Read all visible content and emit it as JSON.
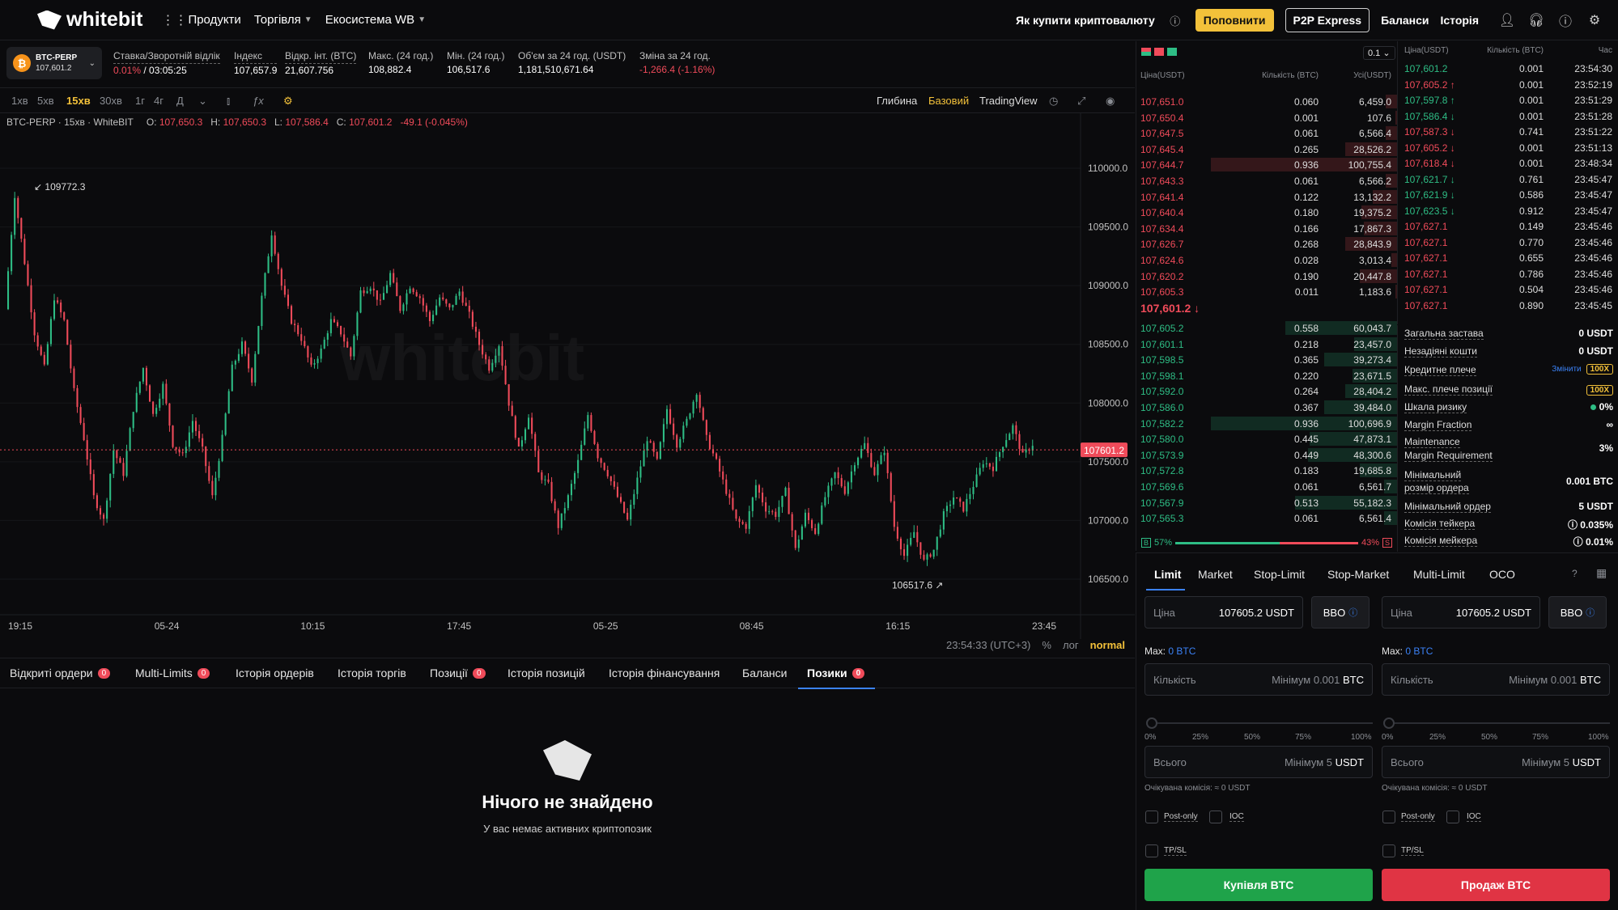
{
  "header": {
    "brand": "whitebit",
    "nav": [
      {
        "label": "Продукти"
      },
      {
        "label": "Торгівля"
      },
      {
        "label": "Екосистема WB"
      }
    ],
    "how_to_buy": "Як купити криптовалюту",
    "deposit": "Поповнити",
    "p2p": "P2P Express",
    "balances": "Баланси",
    "history": "Історія"
  },
  "ticker": {
    "pair": "BTC-PERP",
    "pair_price": "107,601.2",
    "rate_label": "Ставка/Зворотній відлік",
    "rate_value": "0.01%",
    "countdown": " / 03:05:25",
    "index_label": "Індекс",
    "index_value": "107,657.9",
    "oi_label": "Відкр. інт. (BTC)",
    "oi_value": "21,607.756",
    "high_label": "Макс. (24 год.)",
    "high_value": "108,882.4",
    "low_label": "Мін. (24 год.)",
    "low_value": "106,517.6",
    "vol_label": "Об'єм за 24 год. (USDT)",
    "vol_value": "1,181,510,671.64",
    "change_label": "Зміна за 24 год.",
    "change_value": "-1,266.4  (-1.16%)"
  },
  "chart_toolbar": {
    "intervals": [
      "1хв",
      "5хв",
      "15хв",
      "30хв",
      "1г",
      "4г",
      "Д"
    ],
    "active_interval": "15хв",
    "views": [
      "Глибина",
      "Базовий",
      "TradingView"
    ],
    "active_view": "Базовий"
  },
  "ohlc": {
    "symbol": "BTC-PERP · 15хв · WhiteBIT",
    "o_label": "O:",
    "o": "107,650.3",
    "h_label": "H:",
    "h": "107,650.3",
    "l_label": "L:",
    "l": "107,586.4",
    "c_label": "C:",
    "c": "107,601.2",
    "change": "-49.1 (-0.045%)"
  },
  "chart_data": {
    "type": "candlestick",
    "y_ticks": [
      "110000.0",
      "109500.0",
      "109000.0",
      "108500.0",
      "108000.0",
      "107500.0",
      "107000.0",
      "106500.0"
    ],
    "ylim": [
      106300,
      110400
    ],
    "x_ticks": [
      "19:15",
      "05-24",
      "10:15",
      "17:45",
      "05-25",
      "08:45",
      "16:15",
      "23:45"
    ],
    "last_price": "107601.2",
    "last_value": 107601.2,
    "max_label": "109772.3",
    "max_value": 109772.3,
    "min_label": "106517.6",
    "min_value": 106517.6,
    "time": "23:54:33 (UTC+3)",
    "opts": [
      "%",
      "лог",
      "normal"
    ],
    "watermark": "whitebit",
    "path": [
      108800,
      109772,
      109200,
      108600,
      108300,
      108900,
      108700,
      108100,
      107700,
      107200,
      107000,
      107600,
      107400,
      107950,
      108300,
      107900,
      108150,
      107650,
      107550,
      107850,
      107600,
      107200,
      107700,
      108300,
      108500,
      108200,
      108900,
      109450,
      109000,
      108700,
      108550,
      108300,
      108450,
      108700,
      108600,
      108400,
      108950,
      109000,
      108850,
      109100,
      108800,
      109000,
      108900,
      108700,
      108900,
      108800,
      108950,
      108750,
      108500,
      108300,
      108500,
      108000,
      107600,
      107900,
      107400,
      107300,
      106950,
      107200,
      107500,
      107900,
      107550,
      107400,
      107200,
      107000,
      107350,
      107700,
      107500,
      107950,
      107650,
      107850,
      108100,
      107700,
      107500,
      107250,
      107000,
      106950,
      107300,
      107100,
      107050,
      107250,
      106750,
      107050,
      106900,
      107200,
      107400,
      107250,
      107500,
      107650,
      107400,
      107600,
      106950,
      106700,
      106900,
      106650,
      106750,
      107050,
      107200,
      107100,
      107300,
      107500,
      107450,
      107650,
      107800,
      107550,
      107650
    ]
  },
  "bottom_tabs": [
    {
      "label": "Відкриті ордери",
      "badge": "0"
    },
    {
      "label": "Multi-Limits",
      "badge": "0"
    },
    {
      "label": "Історія ордерів"
    },
    {
      "label": "Історія торгів"
    },
    {
      "label": "Позиції",
      "badge": "0"
    },
    {
      "label": "Історія позицій"
    },
    {
      "label": "Історія фінансування"
    },
    {
      "label": "Баланси"
    },
    {
      "label": "Позики",
      "badge": "0"
    }
  ],
  "active_bottom_tab": "Позики",
  "empty": {
    "title": "Нічого не знайдено",
    "subtitle": "У вас немає активних криптопозик"
  },
  "orderbook": {
    "precision": "0.1",
    "headers": [
      "Ціна(USDT)",
      "Кількість (BTC)",
      "Усі(USDT)"
    ],
    "asks": [
      {
        "p": "107,651.0",
        "q": "0.060",
        "s": "6,459.0",
        "d": 0.06
      },
      {
        "p": "107,650.4",
        "q": "0.001",
        "s": "107.6",
        "d": 0.01
      },
      {
        "p": "107,647.5",
        "q": "0.061",
        "s": "6,566.4",
        "d": 0.06
      },
      {
        "p": "107,645.4",
        "q": "0.265",
        "s": "28,526.2",
        "d": 0.28
      },
      {
        "p": "107,644.7",
        "q": "0.936",
        "s": "100,755.4",
        "d": 1.0
      },
      {
        "p": "107,643.3",
        "q": "0.061",
        "s": "6,566.2",
        "d": 0.06
      },
      {
        "p": "107,641.4",
        "q": "0.122",
        "s": "13,132.2",
        "d": 0.13
      },
      {
        "p": "107,640.4",
        "q": "0.180",
        "s": "19,375.2",
        "d": 0.19
      },
      {
        "p": "107,634.4",
        "q": "0.166",
        "s": "17,867.3",
        "d": 0.18
      },
      {
        "p": "107,626.7",
        "q": "0.268",
        "s": "28,843.9",
        "d": 0.28
      },
      {
        "p": "107,624.6",
        "q": "0.028",
        "s": "3,013.4",
        "d": 0.03
      },
      {
        "p": "107,620.2",
        "q": "0.190",
        "s": "20,447.8",
        "d": 0.2
      },
      {
        "p": "107,605.3",
        "q": "0.011",
        "s": "1,183.6",
        "d": 0.01
      }
    ],
    "mid": "107,601.2 ↓",
    "bids": [
      {
        "p": "107,605.2",
        "q": "0.558",
        "s": "60,043.7",
        "d": 0.6
      },
      {
        "p": "107,601.1",
        "q": "0.218",
        "s": "23,457.0",
        "d": 0.23
      },
      {
        "p": "107,598.5",
        "q": "0.365",
        "s": "39,273.4",
        "d": 0.39
      },
      {
        "p": "107,598.1",
        "q": "0.220",
        "s": "23,671.5",
        "d": 0.24
      },
      {
        "p": "107,592.0",
        "q": "0.264",
        "s": "28,404.2",
        "d": 0.28
      },
      {
        "p": "107,586.0",
        "q": "0.367",
        "s": "39,484.0",
        "d": 0.39
      },
      {
        "p": "107,582.2",
        "q": "0.936",
        "s": "100,696.9",
        "d": 1.0
      },
      {
        "p": "107,580.0",
        "q": "0.445",
        "s": "47,873.1",
        "d": 0.47
      },
      {
        "p": "107,573.9",
        "q": "0.449",
        "s": "48,300.6",
        "d": 0.48
      },
      {
        "p": "107,572.8",
        "q": "0.183",
        "s": "19,685.8",
        "d": 0.2
      },
      {
        "p": "107,569.6",
        "q": "0.061",
        "s": "6,561.7",
        "d": 0.07
      },
      {
        "p": "107,567.9",
        "q": "0.513",
        "s": "55,182.3",
        "d": 0.55
      },
      {
        "p": "107,565.3",
        "q": "0.061",
        "s": "6,561.4",
        "d": 0.07
      }
    ],
    "buy_pct": "57%",
    "sell_pct": "43%",
    "buy_ratio": 0.57,
    "b_label": "B",
    "s_label": "S"
  },
  "trades": {
    "headers": [
      "Ціна(USDT)",
      "Кількість (BTC)",
      "Час"
    ],
    "rows": [
      {
        "p": "107,601.2",
        "q": "0.001",
        "t": "23:54:30",
        "side": "buy"
      },
      {
        "p": "107,605.2 ↑",
        "q": "0.001",
        "t": "23:52:19",
        "side": "sell"
      },
      {
        "p": "107,597.8 ↑",
        "q": "0.001",
        "t": "23:51:29",
        "side": "buy"
      },
      {
        "p": "107,586.4 ↓",
        "q": "0.001",
        "t": "23:51:28",
        "side": "buy"
      },
      {
        "p": "107,587.3 ↓",
        "q": "0.741",
        "t": "23:51:22",
        "side": "sell"
      },
      {
        "p": "107,605.2 ↓",
        "q": "0.001",
        "t": "23:51:13",
        "side": "sell"
      },
      {
        "p": "107,618.4 ↓",
        "q": "0.001",
        "t": "23:48:34",
        "side": "sell"
      },
      {
        "p": "107,621.7 ↓",
        "q": "0.761",
        "t": "23:45:47",
        "side": "buy"
      },
      {
        "p": "107,621.9 ↓",
        "q": "0.586",
        "t": "23:45:47",
        "side": "buy"
      },
      {
        "p": "107,623.5 ↓",
        "q": "0.912",
        "t": "23:45:47",
        "side": "buy"
      },
      {
        "p": "107,627.1",
        "q": "0.149",
        "t": "23:45:46",
        "side": "sell"
      },
      {
        "p": "107,627.1",
        "q": "0.770",
        "t": "23:45:46",
        "side": "sell"
      },
      {
        "p": "107,627.1",
        "q": "0.655",
        "t": "23:45:46",
        "side": "sell"
      },
      {
        "p": "107,627.1",
        "q": "0.786",
        "t": "23:45:46",
        "side": "sell"
      },
      {
        "p": "107,627.1",
        "q": "0.504",
        "t": "23:45:46",
        "side": "sell"
      },
      {
        "p": "107,627.1",
        "q": "0.890",
        "t": "23:45:45",
        "side": "sell"
      }
    ]
  },
  "account": {
    "total_margin_label": "Загальна застава",
    "total_margin": "0 USDT",
    "free_label": "Незадіяні кошти",
    "free": "0 USDT",
    "leverage_label": "Кредитне плече",
    "leverage_change": "Змінити",
    "leverage": "100X",
    "max_lev_label": "Макс. плече позиції",
    "max_lev": "100X",
    "risk_label": "Шкала ризику",
    "risk": "0%",
    "mf_label": "Margin Fraction",
    "mf": "∞",
    "mmr_label1": "Maintenance",
    "mmr_label2": "Margin Requirement",
    "mmr": "3%",
    "min_size_label1": "Мінімальний",
    "min_size_label2": "розмір ордера",
    "min_size": "0.001 BTC",
    "min_order_label": "Мінімальний ордер",
    "min_order": "5 USDT",
    "taker_label": "Комісія тейкера",
    "taker": "0.035%",
    "maker_label": "Комісія мейкера",
    "maker": "0.01%"
  },
  "order_form": {
    "tabs": [
      "Limit",
      "Market",
      "Stop-Limit",
      "Stop-Market",
      "Multi-Limit",
      "OCO"
    ],
    "active_tab": "Limit",
    "price_label": "Ціна",
    "price_value": "107605.2",
    "currency_usdt": "USDT",
    "currency_btc": "BTC",
    "bbo": "BBO",
    "max_label": "Max:",
    "max_value": "0 BTC",
    "qty_label": "Кількість",
    "qty_placeholder": "Мінімум 0.001",
    "total_label": "Всього",
    "total_placeholder": "Мінімум 5",
    "pcts": [
      "0%",
      "25%",
      "50%",
      "75%",
      "100%"
    ],
    "fee": "Очікувана комісія: ≈ 0 USDT",
    "post_only": "Post-only",
    "ioc": "IOC",
    "tpsl": "TP/SL",
    "buy": "Купівля BTC",
    "sell": "Продаж BTC"
  },
  "colors": {
    "up": "#2ebd85",
    "down": "#f04b5a",
    "accent": "#f3c13a",
    "blue": "#3b82f6"
  }
}
